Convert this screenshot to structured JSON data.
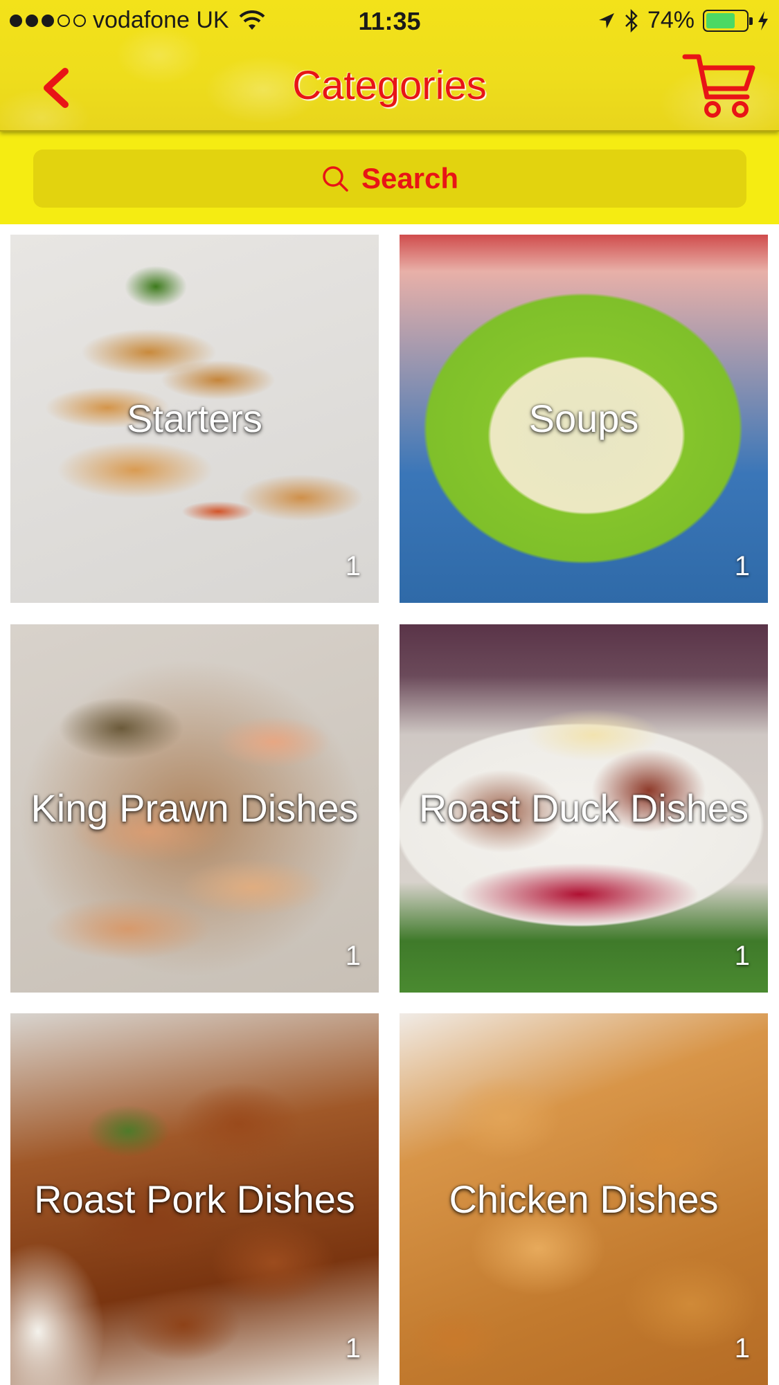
{
  "status_bar": {
    "carrier": "vodafone UK",
    "time": "11:35",
    "battery": "74%",
    "battery_level": 0.74
  },
  "nav": {
    "title": "Categories",
    "back_icon": "chevron-left-icon",
    "cart_icon": "shopping-cart-icon"
  },
  "search": {
    "label": "Search",
    "icon": "search-icon"
  },
  "colors": {
    "header_yellow": "#f3e21a",
    "accent_red": "#e81416",
    "search_field": "#e2d30f"
  },
  "categories": [
    {
      "name": "Starters",
      "count": "1"
    },
    {
      "name": "Soups",
      "count": "1"
    },
    {
      "name": "King Prawn Dishes",
      "count": "1"
    },
    {
      "name": "Roast Duck Dishes",
      "count": "1"
    },
    {
      "name": "Roast Pork Dishes",
      "count": "1"
    },
    {
      "name": "Chicken Dishes",
      "count": "1"
    }
  ]
}
